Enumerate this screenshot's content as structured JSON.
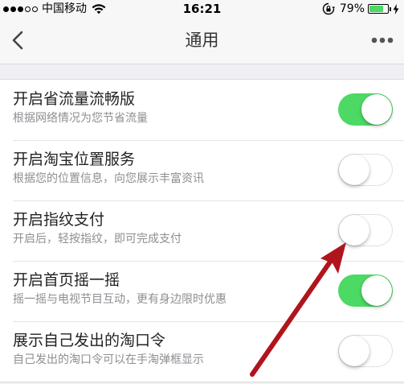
{
  "status_bar": {
    "carrier": "中国移动",
    "time": "16:21",
    "battery_percent": "79%",
    "battery_level": 0.79,
    "signal_filled": 3,
    "signal_total": 5
  },
  "nav": {
    "title": "通用",
    "back_icon": "chevron-left-icon",
    "more_icon": "more-dots-icon"
  },
  "settings": [
    {
      "title": "开启省流量流畅版",
      "desc": "根据网络情况为您节省流量",
      "enabled": true
    },
    {
      "title": "开启淘宝位置服务",
      "desc": "根据您的位置信息，向您展示丰富资讯",
      "enabled": false
    },
    {
      "title": "开启指纹支付",
      "desc": "开启后，轻按指纹，即可完成支付",
      "enabled": false
    },
    {
      "title": "开启首页摇一摇",
      "desc": "摇一摇与电视节目互动，更有身边限时优惠",
      "enabled": true
    },
    {
      "title": "展示自己发出的淘口令",
      "desc": "自己发出的淘口令可以在手淘弹框显示",
      "enabled": false
    }
  ],
  "colors": {
    "toggle_on": "#4cd964",
    "annotation_arrow": "#b0141c"
  }
}
